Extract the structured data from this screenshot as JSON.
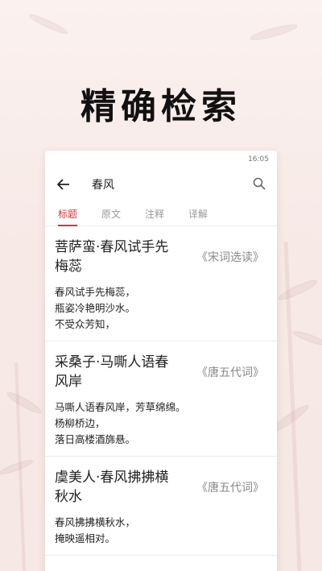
{
  "headline": "精确检索",
  "statusbar": {
    "time": "16:05"
  },
  "search": {
    "query": "春风"
  },
  "tabs": [
    {
      "label": "标题",
      "active": true
    },
    {
      "label": "原文",
      "active": false
    },
    {
      "label": "注释",
      "active": false
    },
    {
      "label": "译解",
      "active": false
    }
  ],
  "results": [
    {
      "title": "菩萨蛮·春风试手先梅蕊",
      "source": "《宋词选读》",
      "lines": [
        "春风试手先梅蕊，",
        "瓶姿冷艳明沙水。",
        "不受众芳知，"
      ]
    },
    {
      "title": "采桑子·马嘶人语春风岸",
      "source": "《唐五代词》",
      "lines": [
        "马嘶人语春风岸，芳草绵绵。",
        "杨柳桥边，",
        "落日高楼酒旆悬。"
      ]
    },
    {
      "title": "虞美人·春风拂拂横秋水",
      "source": "《唐五代词》",
      "lines": [
        "春风拂拂横秋水，",
        "掩映遥相对。"
      ]
    }
  ],
  "colors": {
    "accent": "#d0383a",
    "background": "#f7ebe8"
  }
}
